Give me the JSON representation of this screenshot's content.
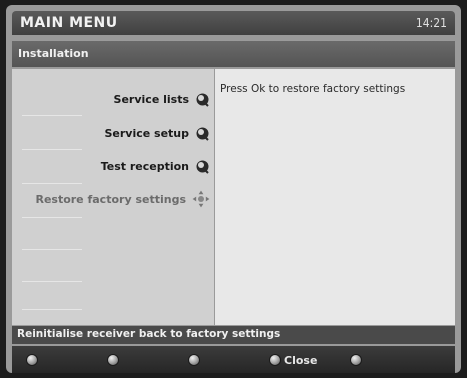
{
  "header": {
    "title": "MAIN MENU",
    "time": "14:21"
  },
  "submenu": {
    "title": "Installation"
  },
  "menu": {
    "items": [
      {
        "label": "Service lists",
        "icon": "satellite-dish-icon",
        "selected": false
      },
      {
        "label": "Service setup",
        "icon": "satellite-dish-icon",
        "selected": false
      },
      {
        "label": "Test reception",
        "icon": "satellite-dish-icon",
        "selected": false
      },
      {
        "label": "Restore factory settings",
        "icon": "navigation-cross-icon",
        "selected": true
      }
    ]
  },
  "info": {
    "text": "Press Ok to restore factory settings"
  },
  "status": {
    "text": "Reinitialise receiver back to factory settings"
  },
  "buttons": [
    {
      "label": ""
    },
    {
      "label": ""
    },
    {
      "label": ""
    },
    {
      "label": "Close"
    },
    {
      "label": ""
    }
  ],
  "colors": {
    "frame": "#9a9a9a",
    "title_bar": "#4a4a4a",
    "left_panel": "#d0d0d0",
    "right_panel": "#e8e8e8",
    "selected_text": "#6b6b6b"
  }
}
